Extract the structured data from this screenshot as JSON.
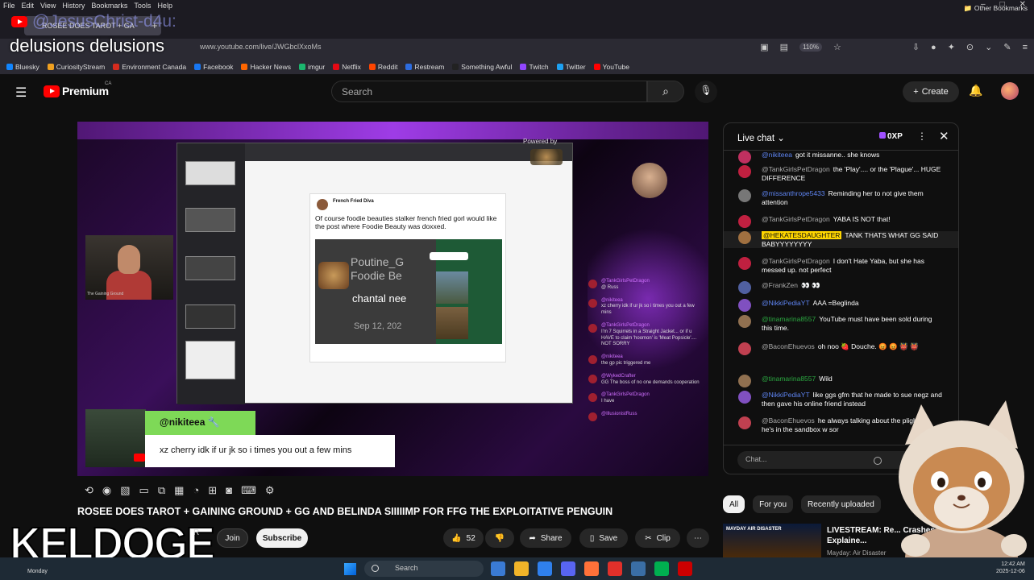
{
  "browser": {
    "menu": [
      "File",
      "Edit",
      "View",
      "History",
      "Bookmarks",
      "Tools",
      "Help"
    ],
    "tab_title": "ROSEE DOES TAROT + GA",
    "url": "www.youtube.com/live/JWGbclXxoMs",
    "zoom": "110%",
    "bookmarks": [
      {
        "label": "Bluesky",
        "color": "#1185fe"
      },
      {
        "label": "CuriosityStream",
        "color": "#f0a020"
      },
      {
        "label": "Environment Canada",
        "color": "#d52b1e"
      },
      {
        "label": "Facebook",
        "color": "#1877f2"
      },
      {
        "label": "Hacker News",
        "color": "#ff6600"
      },
      {
        "label": "imgur",
        "color": "#1bb76e"
      },
      {
        "label": "Netflix",
        "color": "#e50914"
      },
      {
        "label": "Reddit",
        "color": "#ff4500"
      },
      {
        "label": "Restream",
        "color": "#2d6cdf"
      },
      {
        "label": "Something Awful",
        "color": "#222222"
      },
      {
        "label": "Twitch",
        "color": "#9146ff"
      },
      {
        "label": "Twitter",
        "color": "#1da1f2"
      },
      {
        "label": "YouTube",
        "color": "#ff0000"
      }
    ],
    "other_bookmarks": "Other Bookmarks"
  },
  "overlay": {
    "user": "@JesusChrist-d4u:",
    "subtitle": "delusions delusions"
  },
  "youtube": {
    "brand": "Premium",
    "region": "CA",
    "search_placeholder": "Search",
    "create_label": "Create"
  },
  "video": {
    "powered_by": "Powered by",
    "tweet_author": "French Fried Diva",
    "tweet_text": "Of course foodie beauties stalker french fried gorl would like the post where Foodie Beauty was doxxed.",
    "tweet_img_text": "Poutine_G\nFoodie Be",
    "tweet_img_name": "chantal nee",
    "tweet_img_date": "Sep 12, 202",
    "cam_label": "The Gaining Ground",
    "name_tag": "@nikiteea",
    "message": "xz cherry idk if ur jk so i times you out a few mins",
    "stream_chat": [
      {
        "name": "@TankGirlsPetDragon",
        "text": "@ Russ"
      },
      {
        "name": "@nikiteea",
        "text": "xz cherry idk if ur jk so i times you out a few mins"
      },
      {
        "name": "@TankGirlsPetDragon",
        "text": "I'm 7 Squirrels in a Straight Jacket... or if u HAVE to claim 'hoomon' is 'Meat Popsicle'.... NOT SORRY"
      },
      {
        "name": "@nikiteea",
        "text": "the gp pic triggered me"
      },
      {
        "name": "@WykedCrafter",
        "text": "GG The boss of no one demands cooperation"
      },
      {
        "name": "@TankGirlsPetDragon",
        "text": "I have"
      },
      {
        "name": "@IllusionistRuss",
        "text": ""
      }
    ]
  },
  "video_title": "ROSEE DOES TAROT + GAINING GROUND + GG AND BELINDA SIIIIIMP FOR FFG THE EXPLOITATIVE PENGUIN",
  "channel_overlay": "KELDOGE",
  "channel_suffix": "R",
  "actions": {
    "join": "Join",
    "subscribe": "Subscribe",
    "likes": "52",
    "share": "Share",
    "save": "Save",
    "clip": "Clip"
  },
  "live_chat": {
    "title": "Live chat",
    "xp": "0XP",
    "input_placeholder": "Chat...",
    "messages": [
      {
        "name": "@nikiteea",
        "kind": "mod",
        "text": "got it missanne.. she knows",
        "color": "#c03060"
      },
      {
        "name": "@TankGirlsPetDragon",
        "kind": "plain",
        "text": "the 'Play'.... or the 'Plague'... HUGE DIFFERENCE",
        "color": "#c02040"
      },
      {
        "name": "@missanthrope5433",
        "kind": "mod",
        "text": "Reminding her to not give them attention",
        "color": "#777777"
      },
      {
        "name": "@TankGirlsPetDragon",
        "kind": "plain",
        "text": "YABA IS NOT that!",
        "color": "#c02040"
      },
      {
        "name": "@HEKATESDAUGHTER",
        "kind": "hl",
        "text": "TANK THATS WHAT GG SAID BABYYYYYYYY",
        "color": "#a07040"
      },
      {
        "name": "@TankGirlsPetDragon",
        "kind": "plain",
        "text": "I don't Hate Yaba, but she has messed up. not perfect",
        "color": "#c02040"
      },
      {
        "name": "@FrankZen",
        "kind": "plain",
        "text": "👀 👀",
        "color": "#5060a0"
      },
      {
        "name": "@NikkiPediaYT",
        "kind": "mod",
        "text": "AAA =Beglinda",
        "color": "#8050c0"
      },
      {
        "name": "@tinamarina8557",
        "kind": "mem",
        "text": "YouTube must have been sold during this time.",
        "color": "#907050"
      },
      {
        "name": "@BaconEhuevos",
        "kind": "plain",
        "text": "oh noo 🍓 Douche. 😡 😡 👹 👹",
        "color": "#c04050"
      },
      {
        "name": "@tinamarina8557",
        "kind": "mem",
        "text": "Wild",
        "color": "#907050"
      },
      {
        "name": "@NikkiPediaYT",
        "kind": "mod",
        "text": "like ggs gfm that he made to sue negz and then gave his online friend instead",
        "color": "#8050c0"
      },
      {
        "name": "@BaconEhuevos",
        "kind": "plain",
        "text": "he always talking about the plight yet he's in the sandbox w sor",
        "color": "#c04050"
      }
    ]
  },
  "filters": [
    "All",
    "For you",
    "Recently uploaded"
  ],
  "recommendation": {
    "badge": "MAYDAY AIR DISASTER",
    "title": "LIVESTREAM: Re... Crashes Explaine...",
    "channel": "Mayday: Air Disaster"
  },
  "taskbar": {
    "weather": "Monday",
    "search": "Search",
    "time": "12:42 AM",
    "date": "2025-12-06",
    "app_colors": [
      "#3a7bd5",
      "#f0b429",
      "#2f80ed",
      "#5865f2",
      "#ff7139",
      "#e0302a",
      "#3a6ea5",
      "#00b050",
      "#cc0000"
    ]
  }
}
